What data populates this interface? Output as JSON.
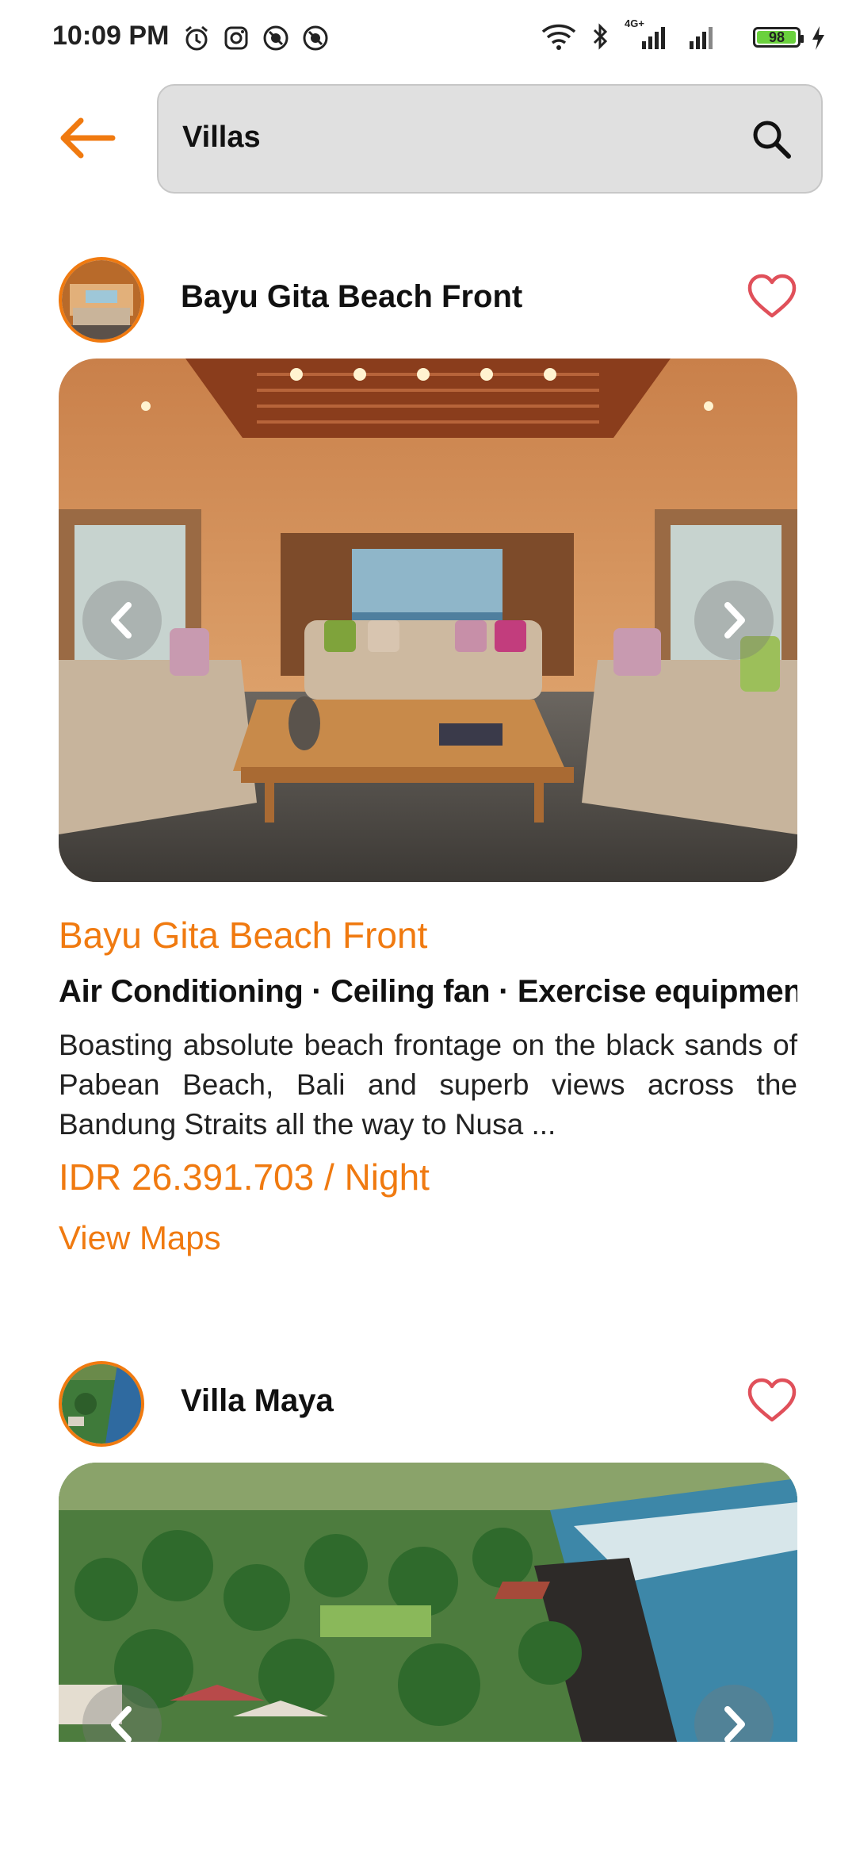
{
  "status_bar": {
    "time": "10:09 PM",
    "battery": "98",
    "battery_level": 0.98,
    "network_label": "4G+"
  },
  "search": {
    "value": "Villas"
  },
  "listings": [
    {
      "host_name": "Bayu Gita Beach Front",
      "title": "Bayu Gita Beach Front",
      "amenities": "Air Conditioning · Ceiling fan · Exercise equipmen",
      "description": "Boasting absolute beach frontage on the black sands of Pabean Beach, Bali and superb views across the Bandung Straits all the way to Nusa ...",
      "price": "IDR 26.391.703 / Night",
      "maps_label": "View Maps"
    },
    {
      "host_name": "Villa Maya"
    }
  ],
  "colors": {
    "accent": "#f07a10",
    "heart": "#e0505a",
    "search_bg": "#e0e0e0"
  }
}
